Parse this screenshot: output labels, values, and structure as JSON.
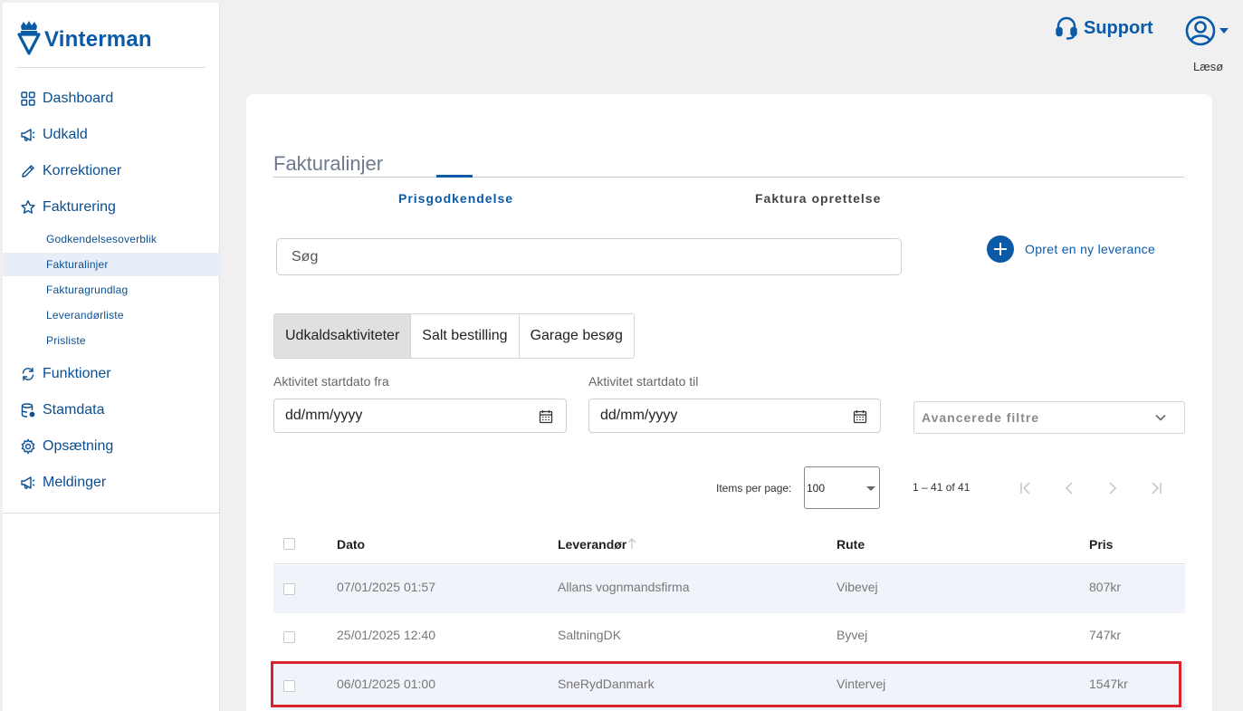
{
  "brand": {
    "name": "Vinterman",
    "logo_icon": "crown-v-logo-icon"
  },
  "sidebar": {
    "items": [
      {
        "label": "Dashboard",
        "icon": "grid-icon"
      },
      {
        "label": "Udkald",
        "icon": "megaphone-icon"
      },
      {
        "label": "Korrektioner",
        "icon": "pencil-icon"
      },
      {
        "label": "Fakturering",
        "icon": "star-icon"
      }
    ],
    "sub_items": [
      {
        "label": "Godkendelsesoverblik"
      },
      {
        "label": "Fakturalinjer",
        "active": true
      },
      {
        "label": "Fakturagrundlag"
      },
      {
        "label": "Leverandørliste"
      },
      {
        "label": "Prisliste"
      }
    ],
    "items_after": [
      {
        "label": "Funktioner",
        "icon": "refresh-icon"
      },
      {
        "label": "Stamdata",
        "icon": "database-icon"
      },
      {
        "label": "Opsætning",
        "icon": "gear-icon"
      },
      {
        "label": "Meldinger",
        "icon": "megaphone-icon"
      }
    ]
  },
  "header": {
    "support_label": "Support",
    "municipality": "Læsø"
  },
  "main": {
    "title": "Fakturalinjer",
    "tabs": [
      {
        "label": "Prisgodkendelse",
        "active": true
      },
      {
        "label": "Faktura oprettelse",
        "active": false
      }
    ],
    "search_placeholder": "Søg",
    "new_delivery_label": "Opret en ny leverance",
    "toggles": [
      {
        "label": "Udkaldsaktiviteter",
        "active": true
      },
      {
        "label": "Salt bestilling",
        "active": false
      },
      {
        "label": "Garage besøg",
        "active": false
      }
    ],
    "date_from_label": "Aktivitet startdato fra",
    "date_from_value": "dd/mm/yyyy",
    "date_to_label": "Aktivitet startdato til",
    "date_to_value": "dd/mm/yyyy",
    "advanced_filter_label": "Avancerede filtre"
  },
  "paginator": {
    "items_per_page_label": "Items per page:",
    "items_per_page_value": "100",
    "range_label": "1 – 41 of 41"
  },
  "table": {
    "columns": {
      "date": "Dato",
      "supplier": "Leverandør",
      "route": "Rute",
      "price": "Pris"
    },
    "rows": [
      {
        "date": "07/01/2025 01:57",
        "supplier": "Allans vognmandsfirma",
        "route": "Vibevej",
        "price": "807kr"
      },
      {
        "date": "25/01/2025 12:40",
        "supplier": "SaltningDK",
        "route": "Byvej",
        "price": "747kr"
      },
      {
        "date": "06/01/2025 01:00",
        "supplier": "SneRydDanmark",
        "route": "Vintervej",
        "price": "1547kr"
      }
    ]
  },
  "colors": {
    "brand_blue": "#0a5aa8",
    "highlight_red": "#d9232e",
    "row_shade": "#f1f3fa"
  }
}
